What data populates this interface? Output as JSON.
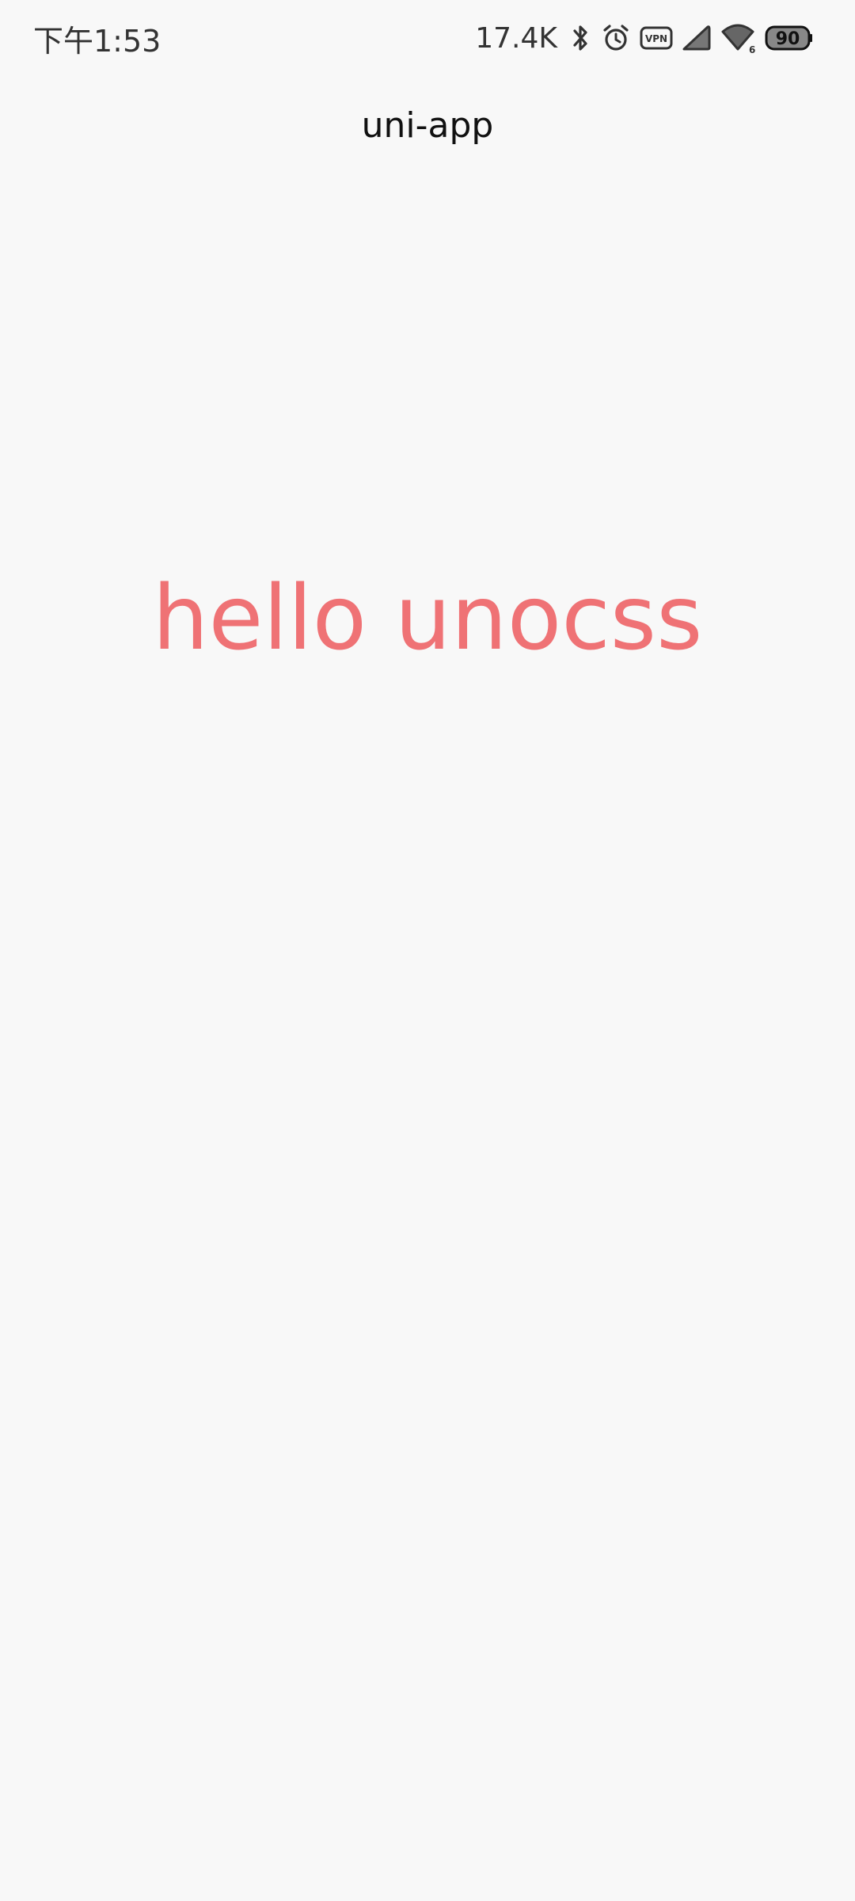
{
  "status_bar": {
    "time": "下午1:53",
    "network_speed": "17.4K",
    "icons": [
      "bluetooth-icon",
      "alarm-icon",
      "vpn-icon",
      "cellular-signal-icon",
      "wifi-icon",
      "battery-icon"
    ],
    "vpn_label": "VPN",
    "wifi_badge": "6",
    "battery_level": "90"
  },
  "nav": {
    "title": "uni-app"
  },
  "content": {
    "greeting": "hello unocss",
    "greeting_color": "#ef7275"
  },
  "colors": {
    "background": "#f8f8f8",
    "status_text": "#333333"
  }
}
